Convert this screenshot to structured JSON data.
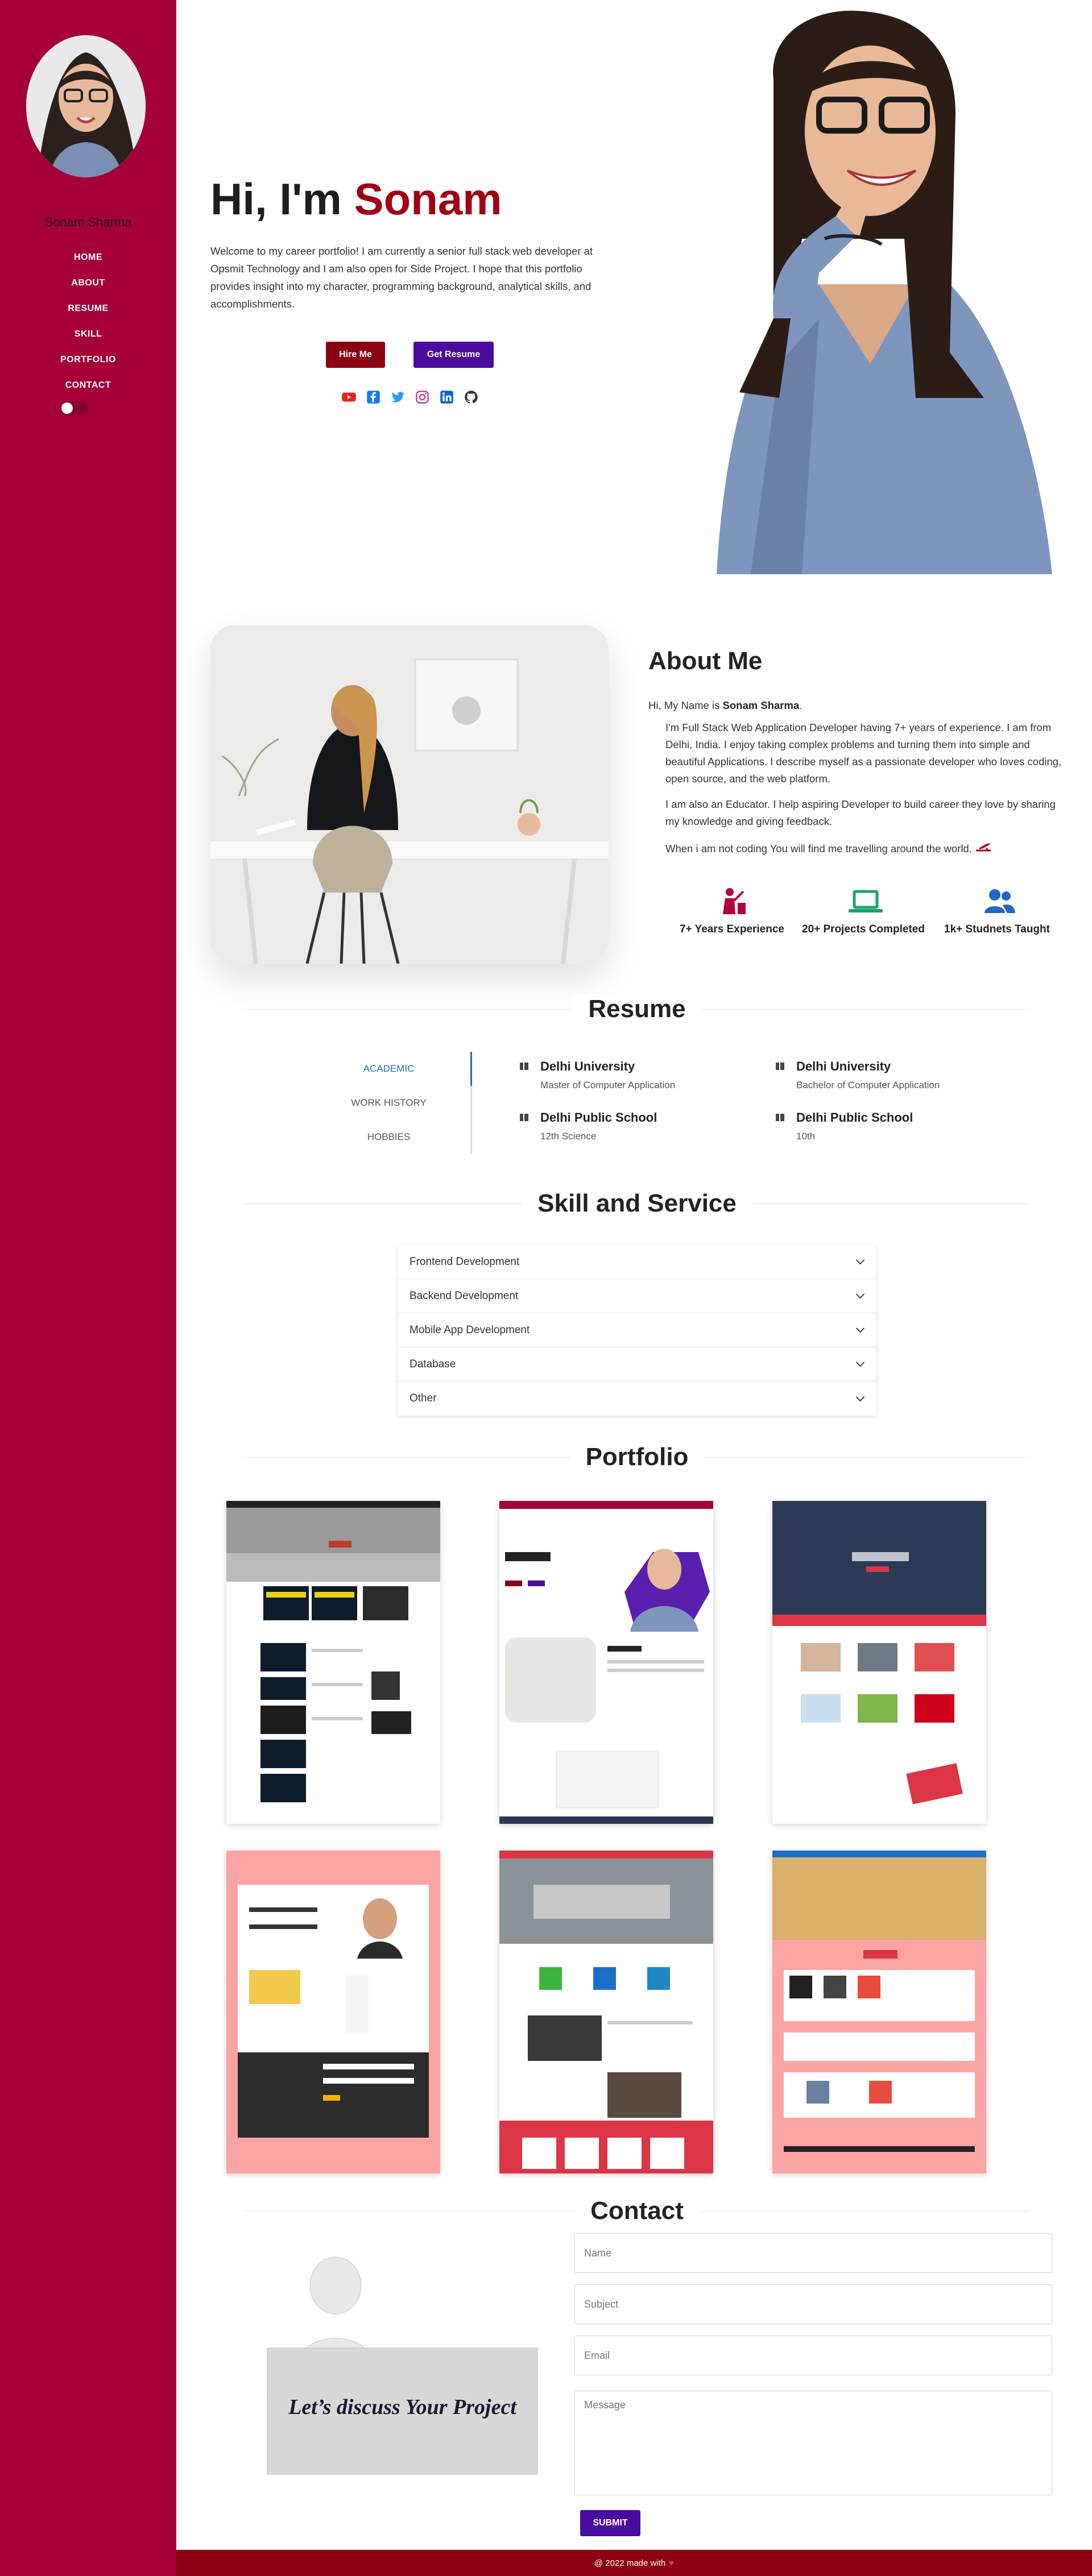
{
  "sidebar": {
    "name": "Sonam Sharma",
    "nav": [
      "HOME",
      "ABOUT",
      "RESUME",
      "SKILL",
      "PORTFOLIO",
      "CONTACT"
    ],
    "dark_mode": false
  },
  "hero": {
    "greeting": "Hi, I'm",
    "name": "Sonam",
    "text": "Welcome to my career portfolio! I am currently a senior full stack web developer at Opsmit Technology and I am also open for Side Project. I hope that this portfolio provides insight into my character, programming background, analytical skills, and accomplishments.",
    "hire_label": "Hire Me",
    "resume_label": "Get Resume",
    "socials": [
      "youtube-icon",
      "facebook-icon",
      "twitter-icon",
      "instagram-icon",
      "linkedin-icon",
      "github-icon"
    ]
  },
  "about": {
    "title": "About Me",
    "intro_prefix": "Hi, My Name is",
    "intro_name": "Sonam Sharma",
    "intro_suffix": ".",
    "p1": "I'm Full Stack Web Application Developer having 7+ years of experience. I am from Delhi, India. I enjoy taking complex problems and turning them into simple and beautiful Applications. I describe myself as a passionate developer who loves coding, open source, and the web platform.",
    "p2": "I am also an Educator. I help aspiring Developer to build career they love by sharing my knowledge and giving feedback.",
    "p3": "When i am not coding You will find me travelling around the world.",
    "stats": [
      "7+ Years Experience",
      "20+ Projects Completed",
      "1k+ Studnets Taught"
    ]
  },
  "resume": {
    "title": "Resume",
    "tabs": [
      "ACADEMIC",
      "WORK HISTORY",
      "HOBBIES"
    ],
    "items": [
      {
        "title": "Delhi University",
        "sub": "Master of Computer Application"
      },
      {
        "title": "Delhi University",
        "sub": "Bachelor of Computer Application"
      },
      {
        "title": "Delhi Public School",
        "sub": "12th Science"
      },
      {
        "title": "Delhi Public School",
        "sub": "10th"
      }
    ]
  },
  "skills": {
    "title": "Skill and Service",
    "items": [
      "Frontend Development",
      "Backend Development",
      "Mobile App Development",
      "Database",
      "Other"
    ]
  },
  "portfolio": {
    "title": "Portfolio",
    "colors": {
      "pink": "#fca4a4",
      "crimson": "#dc3545",
      "navy": "#2b3a55"
    }
  },
  "contact": {
    "title": "Contact",
    "art_text": "Let’s discuss Your Project",
    "name_placeholder": "Name",
    "subject_placeholder": "Subject",
    "email_placeholder": "Email",
    "message_placeholder": "Message",
    "submit_label": "SUBMIT"
  },
  "footer": {
    "text": "@ 2022 made with",
    "heart": "♥"
  },
  "colors": {
    "brand": "#a5003a",
    "accent_red": "#8d0014",
    "accent_purple": "#4a0b9f",
    "link_blue": "#1c6fc8"
  }
}
